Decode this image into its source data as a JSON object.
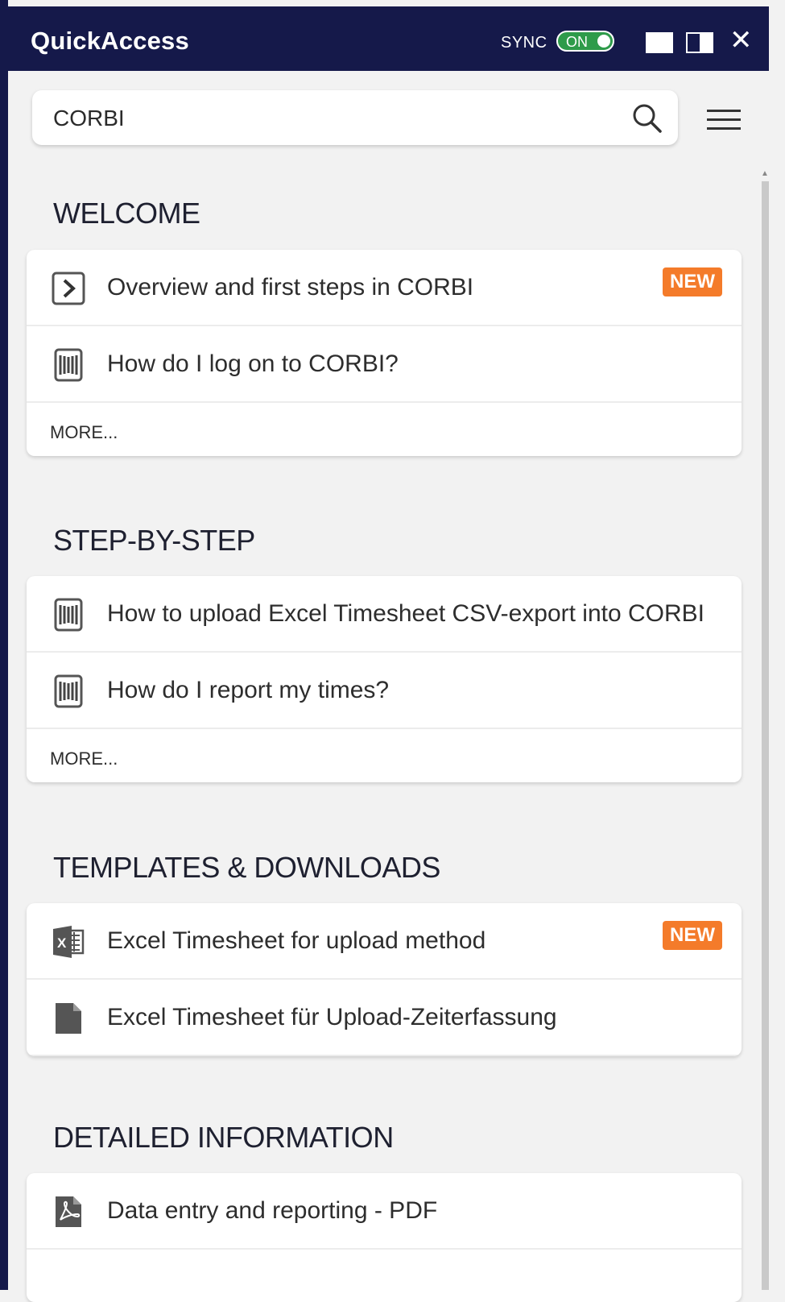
{
  "app": {
    "title": "QuickAccess",
    "sync_label": "SYNC",
    "sync_state": "ON",
    "close_symbol": "✕"
  },
  "search": {
    "value": "CORBI"
  },
  "sections": [
    {
      "title": "WELCOME",
      "items": [
        {
          "label": "Overview and first steps in CORBI",
          "icon": "chevron-right-box-icon",
          "badge": "NEW"
        },
        {
          "label": "How do I log on to CORBI?",
          "icon": "book-icon"
        }
      ],
      "more": "MORE..."
    },
    {
      "title": "STEP-BY-STEP",
      "items": [
        {
          "label": "How to upload Excel Timesheet CSV-export into CORBI",
          "icon": "book-icon"
        },
        {
          "label": "How do I report my times?",
          "icon": "book-icon"
        }
      ],
      "more": "MORE..."
    },
    {
      "title": "TEMPLATES & DOWNLOADS",
      "items": [
        {
          "label": "Excel Timesheet for upload method",
          "icon": "excel-icon",
          "badge": "NEW"
        },
        {
          "label": "Excel Timesheet für Upload-Zeiterfassung",
          "icon": "document-icon"
        }
      ]
    },
    {
      "title": "DETAILED INFORMATION",
      "items": [
        {
          "label": "Data entry and reporting - PDF",
          "icon": "pdf-icon"
        }
      ]
    }
  ],
  "colors": {
    "titlebar": "#15194a",
    "badge": "#f47b2a",
    "toggle_on": "#2e9b4a"
  }
}
